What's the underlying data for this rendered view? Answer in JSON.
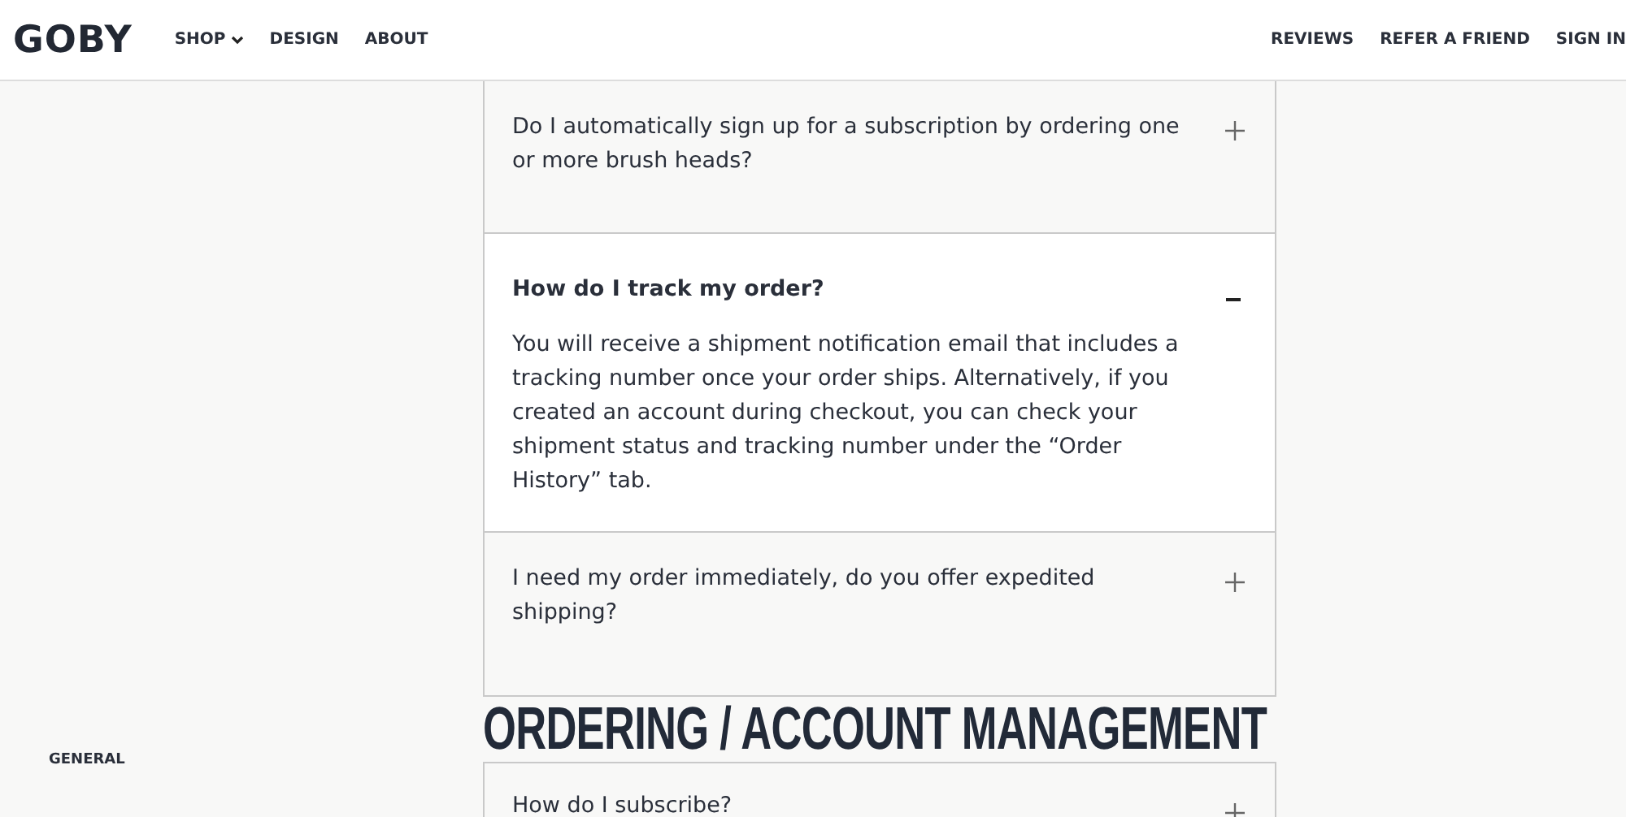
{
  "header": {
    "logo": "GOBY",
    "nav_left": [
      {
        "label": "SHOP",
        "dropdown": true
      },
      {
        "label": "DESIGN",
        "dropdown": false
      },
      {
        "label": "ABOUT",
        "dropdown": false
      }
    ],
    "nav_right": [
      "REVIEWS",
      "REFER A FRIEND",
      "SIGN IN"
    ]
  },
  "sidebar": {
    "items": [
      "GENERAL"
    ]
  },
  "faq": [
    {
      "question": "Do I automatically sign up for a subscription by ordering one or more brush heads?",
      "expanded": false
    },
    {
      "question": "How do I track my order?",
      "expanded": true,
      "answer": "You will receive a shipment notification email that includes a tracking number once your order ships. Alternatively, if you created an account during checkout, you can check your shipment status and tracking number under the “Order History” tab."
    },
    {
      "question": "I need my order immediately, do you offer expedited shipping?",
      "expanded": false
    }
  ],
  "section_heading": "ORDERING / ACCOUNT MANAGEMENT",
  "faq_next": [
    {
      "question": "How do I subscribe?",
      "expanded": false
    }
  ]
}
